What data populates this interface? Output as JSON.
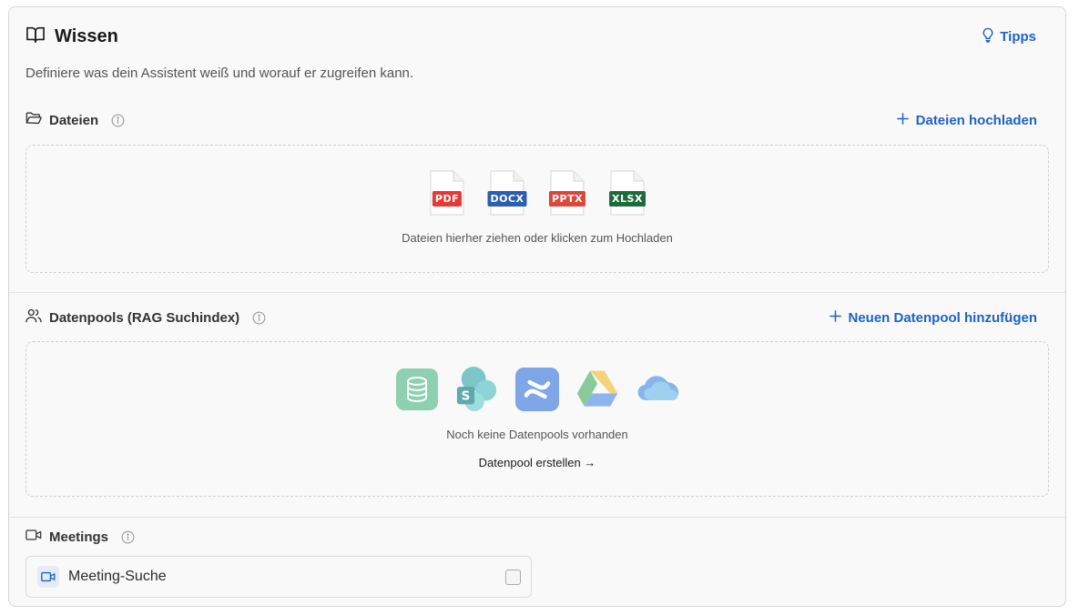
{
  "header": {
    "title": "Wissen",
    "tips_label": "Tipps",
    "subtitle": "Definiere was dein Assistent weiß und worauf er zugreifen kann."
  },
  "files": {
    "title": "Dateien",
    "action_label": "Dateien hochladen",
    "types": [
      "PDF",
      "DOCX",
      "PPTX",
      "XLSX"
    ],
    "type_colors": [
      "#e53935",
      "#2b5fb4",
      "#d9483b",
      "#1e6b3a"
    ],
    "dropzone_text": "Dateien hierher ziehen oder klicken zum Hochladen"
  },
  "datapools": {
    "title": "Datenpools (RAG Suchindex)",
    "action_label": "Neuen Datenpool hinzufügen",
    "sources": [
      "database-icon",
      "sharepoint-icon",
      "confluence-icon",
      "google-drive-icon",
      "onedrive-icon"
    ],
    "empty_text": "Noch keine Datenpools vorhanden",
    "create_label": "Datenpool erstellen →"
  },
  "meetings": {
    "title": "Meetings",
    "item_label": "Meeting-Suche",
    "item_checked": false
  },
  "colors": {
    "accent": "#1e63c4"
  }
}
